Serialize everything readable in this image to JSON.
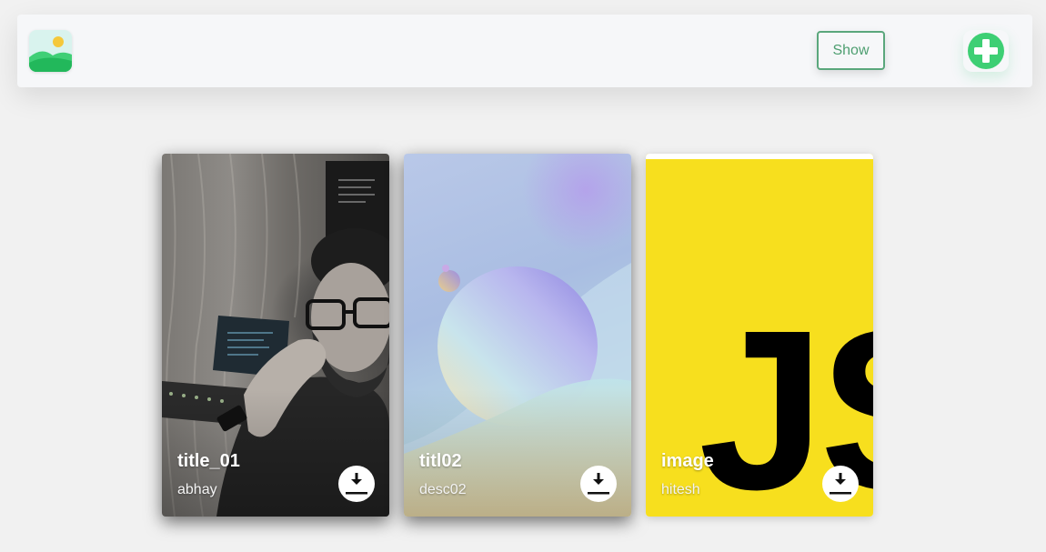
{
  "header": {
    "logo_icon": "image-gallery-icon",
    "show_label": "Show",
    "add_icon": "plus-circle-icon",
    "accent_color": "#3ecf74"
  },
  "cards": [
    {
      "title": "title_01",
      "description": "abhay",
      "image": "portrait-photo",
      "download_icon": "download-icon"
    },
    {
      "title": "titl02",
      "description": "desc02",
      "image": "abstract-sphere-gradient",
      "download_icon": "download-icon"
    },
    {
      "title": "image",
      "description": "hitesh",
      "image": "javascript-logo",
      "logo_text": "JS",
      "download_icon": "download-icon"
    }
  ]
}
